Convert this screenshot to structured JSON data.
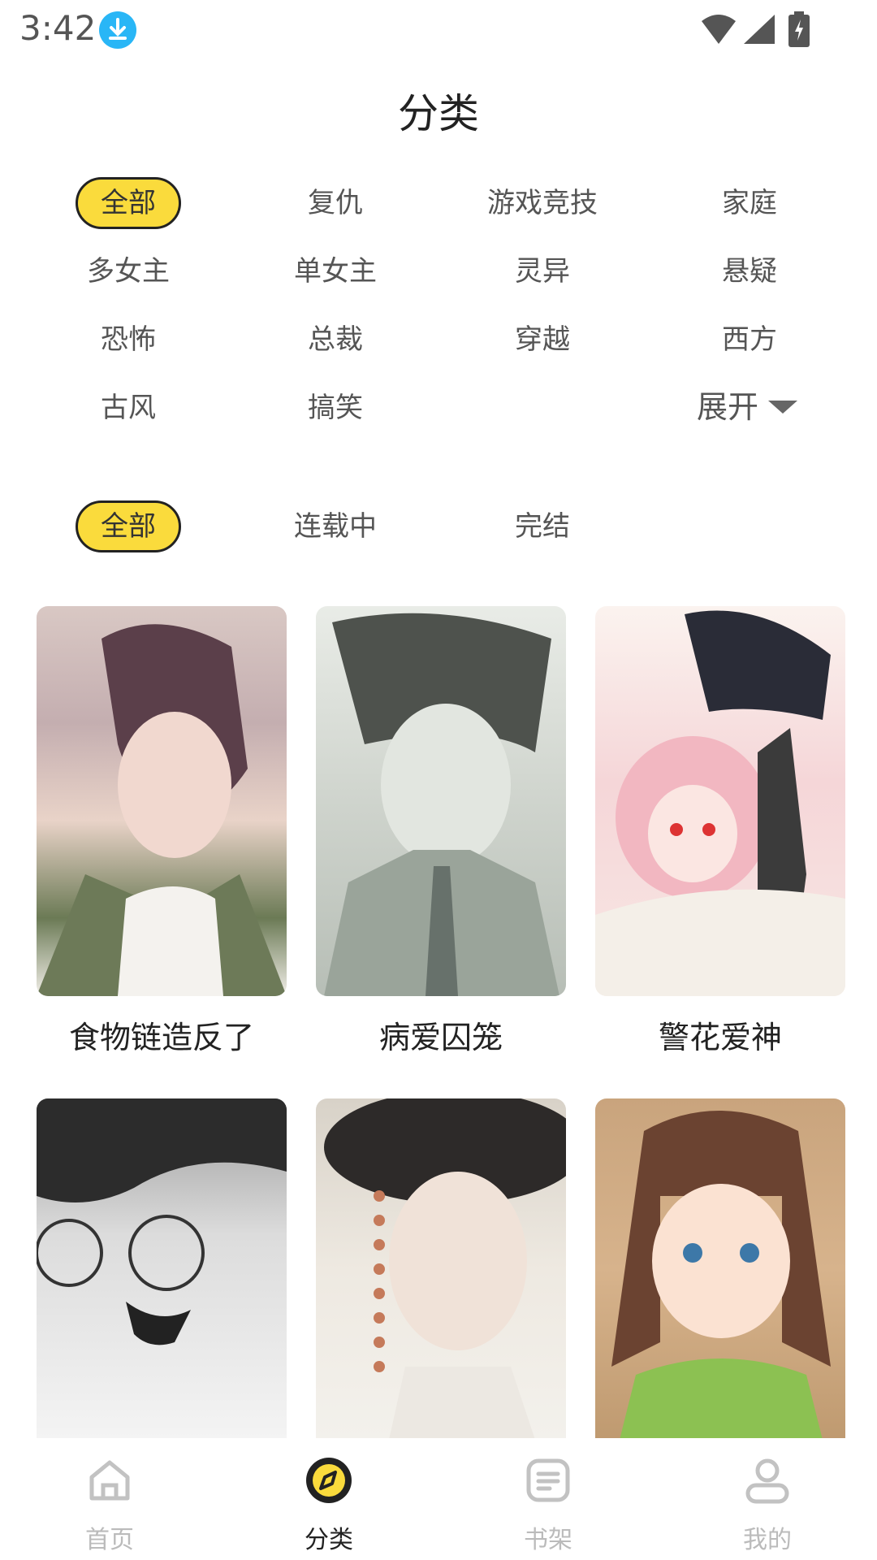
{
  "status": {
    "time": "3:42"
  },
  "page": {
    "title": "分类"
  },
  "genre_tags": [
    "全部",
    "复仇",
    "游戏竞技",
    "家庭",
    "多女主",
    "单女主",
    "灵异",
    "悬疑",
    "恐怖",
    "总裁",
    "穿越",
    "西方",
    "古风",
    "搞笑"
  ],
  "expand_label": "展开",
  "status_tags": [
    "全部",
    "连载中",
    "完结"
  ],
  "comics": [
    {
      "title": "食物链造反了"
    },
    {
      "title": "病爱囚笼"
    },
    {
      "title": "警花爱神"
    },
    {
      "title": ""
    },
    {
      "title": ""
    },
    {
      "title": ""
    }
  ],
  "tabbar": {
    "items": [
      {
        "label": "首页",
        "icon": "home-icon"
      },
      {
        "label": "分类",
        "icon": "compass-icon"
      },
      {
        "label": "书架",
        "icon": "bookshelf-icon"
      },
      {
        "label": "我的",
        "icon": "profile-icon"
      }
    ]
  },
  "colors": {
    "accent": "#fadb3c",
    "inactive": "#bbbbbb",
    "download_badge": "#29b6f6"
  }
}
